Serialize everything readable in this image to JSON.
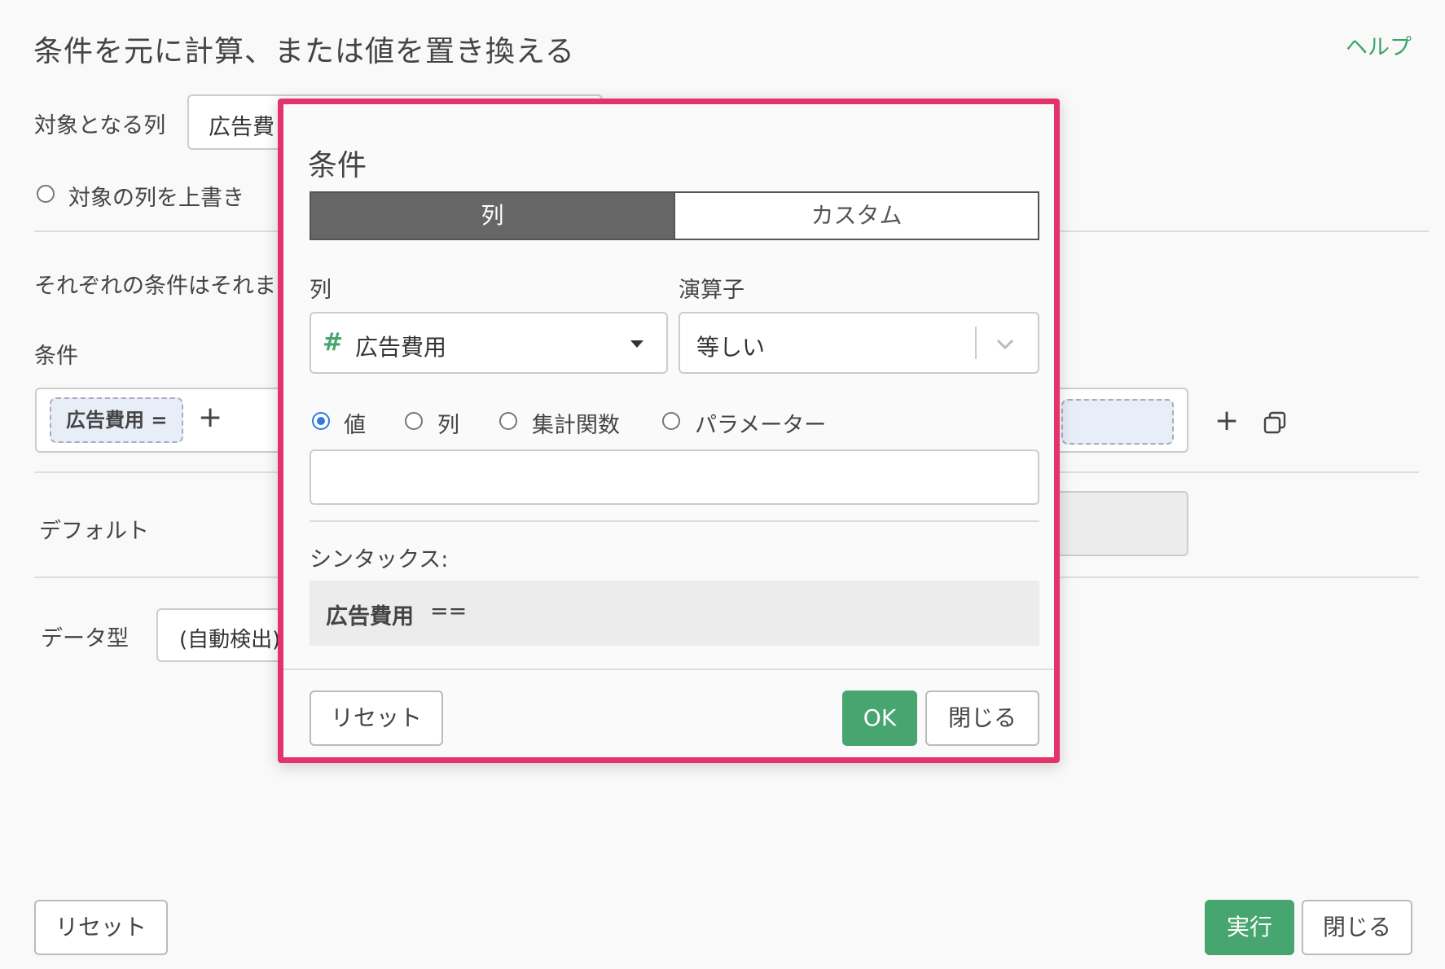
{
  "page": {
    "title": "条件を元に計算、または値を置き換える",
    "help": "ヘルプ",
    "target_column_label": "対象となる列",
    "target_column_value": "広告費",
    "overwrite_label": "対象の列を上書き",
    "description": "それぞれの条件はそれま",
    "condition_label": "条件",
    "condition_chip": "広告費用 =",
    "add_symbol": "+",
    "default_label": "デフォルト",
    "datatype_label": "データ型",
    "datatype_value": "(自動検出)",
    "reset_button": "リセット",
    "run_button": "実行",
    "close_button": "閉じる"
  },
  "modal": {
    "title": "条件",
    "tabs": [
      {
        "label": "列",
        "active": true
      },
      {
        "label": "カスタム",
        "active": false
      }
    ],
    "column_label": "列",
    "column_icon": "#",
    "column_value": "広告費用",
    "operator_label": "演算子",
    "operator_value": "等しい",
    "radio_options": [
      {
        "label": "値",
        "checked": true
      },
      {
        "label": "列",
        "checked": false
      },
      {
        "label": "集計関数",
        "checked": false
      },
      {
        "label": "パラメーター",
        "checked": false
      }
    ],
    "value_input": "",
    "syntax_label": "シンタックス:",
    "syntax_column": "広告費用",
    "syntax_operator": "==",
    "reset_button": "リセット",
    "ok_button": "OK",
    "close_button": "閉じる"
  },
  "colors": {
    "accent_green": "#47a56f",
    "highlight_border": "#e4336a",
    "radio_blue": "#2b7be4"
  }
}
